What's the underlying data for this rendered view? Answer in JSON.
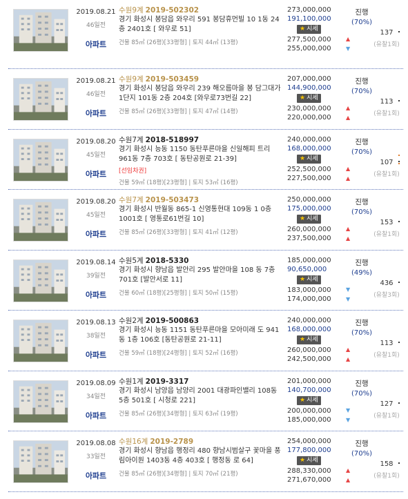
{
  "listings": [
    {
      "date": "2019.08.21",
      "days": "46일전",
      "type": "아파트",
      "court": "수원9계",
      "case": "2019-502302",
      "gold": true,
      "address": "경기 화성시 봉담읍 와우리 591 봉담휴먼빌 10 1동 24층 2401호 [ 와우로 51]",
      "note": "",
      "detail": "건물 85㎡ (26평)[33평형] | 토지 44㎡ (13평)",
      "appraisal": "273,000,000",
      "minimum": "191,100,000",
      "sise": "시세",
      "market1": "277,500,000",
      "market2": "255,000,000",
      "status": "진행",
      "rate": "(70%)",
      "views": "137",
      "fails": "(유찰1회)",
      "arrows": [
        "up",
        "down"
      ]
    },
    {
      "date": "2019.08.21",
      "days": "46일전",
      "type": "아파트",
      "court": "수원9계",
      "case": "2019-503459",
      "gold": true,
      "address": "경기 화성시 봉담읍 와우리 239 해오름마을 봉 담그대가1단지 101동 2층 204호 [와우로73번길 22]",
      "note": "",
      "detail": "건물 85㎡ (26평)[33평형] | 토지 47㎡ (14평)",
      "appraisal": "207,000,000",
      "minimum": "144,900,000",
      "sise": "시세",
      "market1": "230,000,000",
      "market2": "220,000,000",
      "status": "진행",
      "rate": "(70%)",
      "views": "113",
      "fails": "(유찰1회)",
      "arrows": [
        "up",
        "up"
      ]
    },
    {
      "date": "2019.08.20",
      "days": "45일전",
      "type": "아파트",
      "court": "수원7계",
      "case": "2018-518997",
      "gold": false,
      "address": "경기 화성시 능동 1150 동탄푸른마을 신일해피 트리 961동 7층 703호 [ 동탄공원로 21-39]",
      "note": "[선임차권]",
      "detail": "건물 59㎡ (18평)[23평형] | 토지 53㎡ (16평)",
      "appraisal": "240,000,000",
      "minimum": "168,000,000",
      "sise": "시세",
      "market1": "252,500,000",
      "market2": "227,500,000",
      "status": "진행",
      "rate": "(70%)",
      "views": "107",
      "fails": "(유찰1회)",
      "arrows": [
        "up",
        "up"
      ]
    },
    {
      "date": "2019.08.20",
      "days": "45일전",
      "type": "아파트",
      "court": "수원7계",
      "case": "2019-503473",
      "gold": true,
      "address": "경기 화성시 반월동 865-1 신영통현대 109동 1 0층 1001호 [ 영통로61번길 10]",
      "note": "",
      "detail": "건물 85㎡ (26평)[33평형] | 토지 41㎡ (12평)",
      "appraisal": "250,000,000",
      "minimum": "175,000,000",
      "sise": "시세",
      "market1": "260,000,000",
      "market2": "237,500,000",
      "status": "진행",
      "rate": "(70%)",
      "views": "153",
      "fails": "(유찰1회)",
      "arrows": [
        "up",
        "up"
      ]
    },
    {
      "date": "2019.08.14",
      "days": "39일전",
      "type": "아파트",
      "court": "수원5계",
      "case": "2018-5330",
      "gold": false,
      "address": "경기 화성시 향남읍 발안리 295 발안마을 108 동 7층 701호 [발안서로 11]",
      "note": "",
      "detail": "건물 60㎡ (18평)[25평형] | 토지 50㎡ (15평)",
      "appraisal": "185,000,000",
      "minimum": "90,650,000",
      "sise": "시세",
      "market1": "183,000,000",
      "market2": "174,000,000",
      "status": "진행",
      "rate": "(49%)",
      "views": "436",
      "fails": "(유찰3회)",
      "arrows": [
        "down",
        "down"
      ]
    },
    {
      "date": "2019.08.13",
      "days": "38일전",
      "type": "아파트",
      "court": "수원2계",
      "case": "2019-500863",
      "gold": false,
      "address": "경기 화성시 능동 1151 동탄푸른마을 모아미래 도 941동 1층 106호 [동탄공원로 21-11]",
      "note": "",
      "detail": "건물 59㎡ (18평)[24평형] | 토지 52㎡ (16평)",
      "appraisal": "240,000,000",
      "minimum": "168,000,000",
      "sise": "시세",
      "market1": "260,000,000",
      "market2": "242,500,000",
      "status": "진행",
      "rate": "(70%)",
      "views": "113",
      "fails": "(유찰1회)",
      "arrows": [
        "up",
        "up"
      ]
    },
    {
      "date": "2019.08.09",
      "days": "34일전",
      "type": "아파트",
      "court": "수원1계",
      "case": "2019-3317",
      "gold": false,
      "address": "경기 화성시 남양읍 남양리 2001 대광파인밸리 108동 5층 501호 [ 시청로 221]",
      "note": "",
      "detail": "건물 85㎡ (26평)[34평형] | 토지 63㎡ (19평)",
      "appraisal": "201,000,000",
      "minimum": "140,700,000",
      "sise": "시세",
      "market1": "200,000,000",
      "market2": "185,000,000",
      "status": "진행",
      "rate": "(70%)",
      "views": "127",
      "fails": "(유찰1회)",
      "arrows": [
        "down",
        "down"
      ]
    },
    {
      "date": "2019.08.08",
      "days": "33일전",
      "type": "아파트",
      "court": "수원16계",
      "case": "2019-2789",
      "gold": true,
      "address": "경기 화성시 향남읍 행정리 480 향남시범살구 꽃마을 풍림아이원 1403동 4층 403호 [ 행정동 로 64]",
      "note": "",
      "detail": "건물 85㎡ (26평)[34평형] | 토지 70㎡ (21평)",
      "appraisal": "254,000,000",
      "minimum": "177,800,000",
      "sise": "시세",
      "market1": "288,330,000",
      "market2": "271,670,000",
      "status": "진행",
      "rate": "(70%)",
      "views": "158",
      "fails": "(유찰1회)",
      "arrows": [
        "up",
        "up"
      ]
    }
  ]
}
